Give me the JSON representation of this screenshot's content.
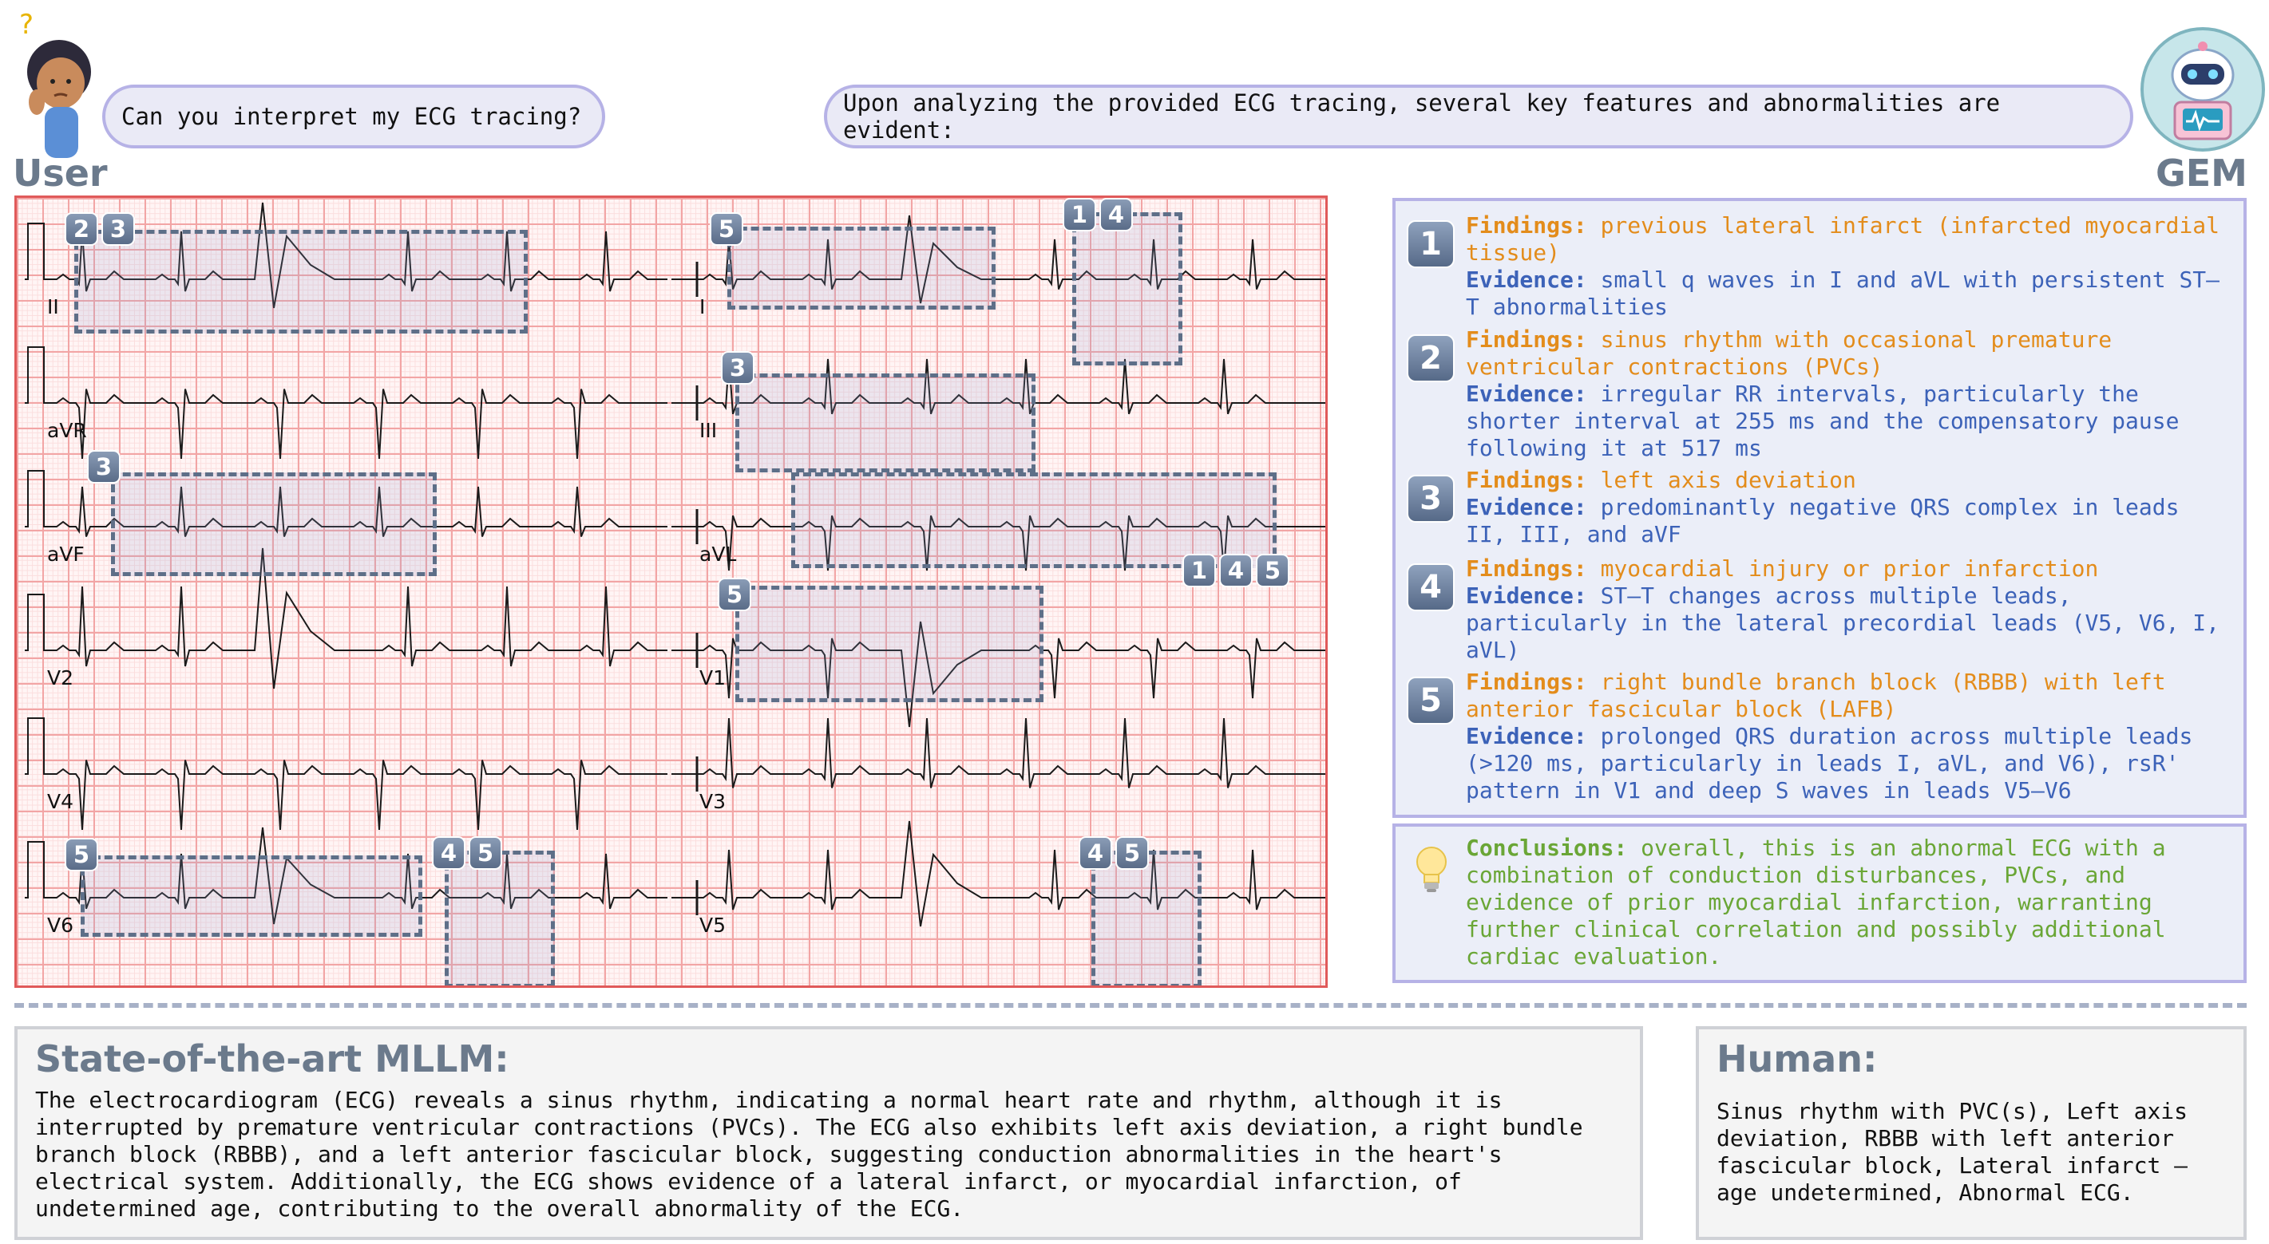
{
  "chat": {
    "user_label": "User",
    "gem_label": "GEM",
    "user_message": "Can you interpret my ECG tracing?",
    "gem_message": "Upon analyzing the provided ECG tracing, several key features and abnormalities are evident:"
  },
  "ecg": {
    "leads": [
      "II",
      "I",
      "aVR",
      "III",
      "aVF",
      "aVL",
      "V2",
      "V1",
      "V4",
      "V3",
      "V6",
      "V5"
    ],
    "badges": {
      "b_row1_a": "2",
      "b_row1_b": "3",
      "b_row1_c": "5",
      "b_row1_d": "1",
      "b_row1_e": "4",
      "b_row2_a": "3",
      "b_row3_a": "3",
      "b_row3_b": "1",
      "b_row3_c": "4",
      "b_row3_d": "5",
      "b_row4_a": "5",
      "b_row6_a": "5",
      "b_row6_b": "4",
      "b_row6_c": "5",
      "b_row6_d": "4",
      "b_row6_e": "5"
    }
  },
  "findings_label": "Findings:",
  "evidence_label": "Evidence:",
  "findings": [
    {
      "num": "1",
      "finding": "previous lateral infarct (infarcted myocardial tissue)",
      "evidence": "small q waves in I and aVL with persistent ST–T abnormalities"
    },
    {
      "num": "2",
      "finding": "sinus rhythm with occasional premature ventricular contractions (PVCs)",
      "evidence": "irregular RR intervals, particularly the shorter interval at 255 ms and the compensatory pause following it at 517 ms"
    },
    {
      "num": "3",
      "finding": "left axis deviation",
      "evidence": "predominantly negative QRS complex in leads II, III, and aVF"
    },
    {
      "num": "4",
      "finding": "myocardial injury or prior infarction",
      "evidence": "ST–T changes across multiple leads, particularly in the lateral precordial leads (V5, V6, I, aVL)"
    },
    {
      "num": "5",
      "finding": "right bundle branch block (RBBB) with left anterior fascicular block (LAFB)",
      "evidence": "prolonged QRS duration across multiple leads (>120 ms, particularly in leads I, aVL, and V6), rsR' pattern in V1 and deep S waves in leads V5–V6"
    }
  ],
  "conclusion": {
    "label": "Conclusions:",
    "text": "overall, this is an abnormal ECG with a combination of conduction disturbances, PVCs, and evidence of prior myocardial infarction, warranting further clinical correlation and possibly additional cardiac evaluation."
  },
  "mllm": {
    "title": "State-of-the-art MLLM:",
    "text": "The electrocardiogram (ECG) reveals a sinus rhythm, indicating a normal heart rate and rhythm, although it is interrupted by premature ventricular contractions (PVCs). The ECG also exhibits left axis deviation, a right bundle branch block (RBBB), and a left anterior fascicular block, suggesting conduction abnormalities in the heart's electrical system. Additionally, the ECG shows evidence of a lateral infarct, or myocardial infarction, of undetermined age, contributing to the overall abnormality of the ECG."
  },
  "human": {
    "title": "Human:",
    "text": "Sinus rhythm with PVC(s), Left axis deviation, RBBB with left anterior fascicular block, Lateral infarct – age undetermined, Abnormal ECG."
  }
}
